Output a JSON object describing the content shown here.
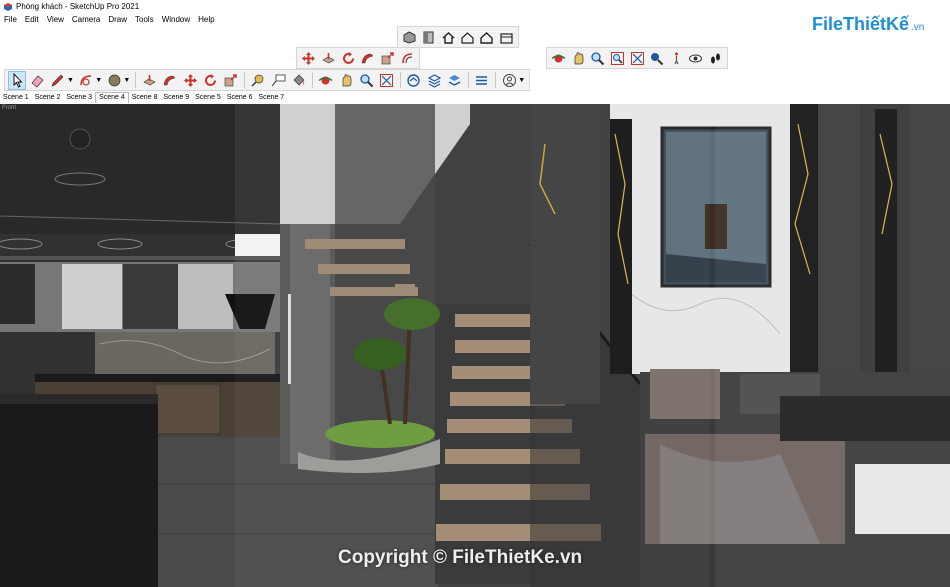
{
  "window": {
    "title": "Phòng khách - SketchUp Pro 2021"
  },
  "menu": [
    "File",
    "Edit",
    "View",
    "Camera",
    "Draw",
    "Tools",
    "Window",
    "Help"
  ],
  "toolbar_top": {
    "icons": [
      "components-icon",
      "materials-icon",
      "home-view-icon",
      "house-outline-icon",
      "house-icon",
      "warehouse-icon"
    ]
  },
  "toolbar_edit": {
    "icons": [
      "move-icon",
      "push-pull-icon",
      "rotate-icon",
      "follow-me-icon",
      "scale-icon",
      "offset-icon"
    ]
  },
  "toolbar_camera": {
    "icons": [
      "orbit-icon",
      "pan-icon",
      "zoom-icon",
      "zoom-window-icon",
      "zoom-extents-icon",
      "position-camera-icon",
      "walk-person-icon",
      "look-around-icon",
      "footprints-icon"
    ]
  },
  "toolbar_main": {
    "icons": [
      "select-icon",
      "eraser-icon",
      "pencil-icon",
      "arc-icon",
      "shape-icon",
      "push-pull-icon",
      "follow-me-icon",
      "move-icon",
      "rotate-icon",
      "scale-icon",
      "tape-measure-icon",
      "text-label-icon",
      "paint-bucket-icon",
      "orbit-icon",
      "pan-icon",
      "zoom-icon",
      "zoom-extents-icon",
      "pan-hand-icon",
      "warehouse-icon",
      "layers-icon",
      "extension-icon",
      "account-icon"
    ]
  },
  "scenes": [
    "Scene 1",
    "Scene 2",
    "Scene 3",
    "Scene 4",
    "Scene 8",
    "Scene 9",
    "Scene 5",
    "Scene 6",
    "Scene 7"
  ],
  "active_scene": "Scene 4",
  "viewport": {
    "label": "Front"
  },
  "brand": {
    "logo_main": "FileThiếtKế",
    "logo_domain": ".vn",
    "watermark": "Copyright © FileThietKe.vn"
  },
  "colors": {
    "accent": "#1f8fd6",
    "red_tool": "#c8342a",
    "toolbar_bg": "#f3f3f3"
  }
}
